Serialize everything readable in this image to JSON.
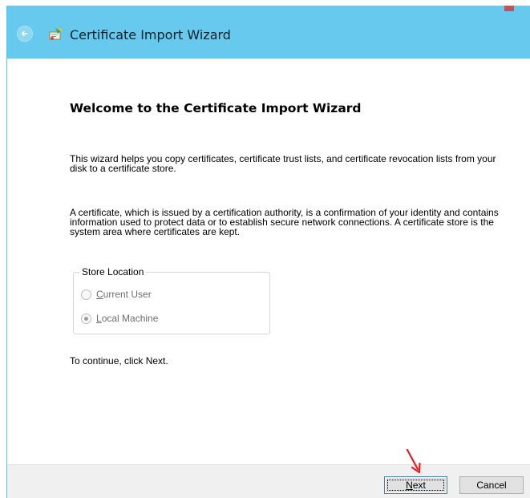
{
  "window": {
    "title": "Certificate Import Wizard"
  },
  "icons": {
    "back": "back-arrow-icon",
    "wizard": "certificate-wizard-icon",
    "annotation": "red-arrow-icon"
  },
  "content": {
    "heading": "Welcome to the Certificate Import Wizard",
    "paragraph1": "This wizard helps you copy certificates, certificate trust lists, and certificate revocation lists from your disk to a certificate store.",
    "paragraph2": "A certificate, which is issued by a certification authority, is a confirmation of your identity and contains information used to protect data or to establish secure network connections. A certificate store is the system area where certificates are kept.",
    "store_location": {
      "legend": "Store Location",
      "options": [
        {
          "mnemonic": "C",
          "rest": "urrent User",
          "selected": false,
          "enabled": false
        },
        {
          "mnemonic": "L",
          "rest": "ocal Machine",
          "selected": true,
          "enabled": false
        }
      ]
    },
    "continue_text": "To continue, click Next."
  },
  "footer": {
    "next": {
      "mnemonic": "N",
      "rest": "ext"
    },
    "cancel": "Cancel"
  },
  "colors": {
    "title_bar": "#67c9ed",
    "footer": "#f0f0f0",
    "annotation": "#e02020"
  }
}
